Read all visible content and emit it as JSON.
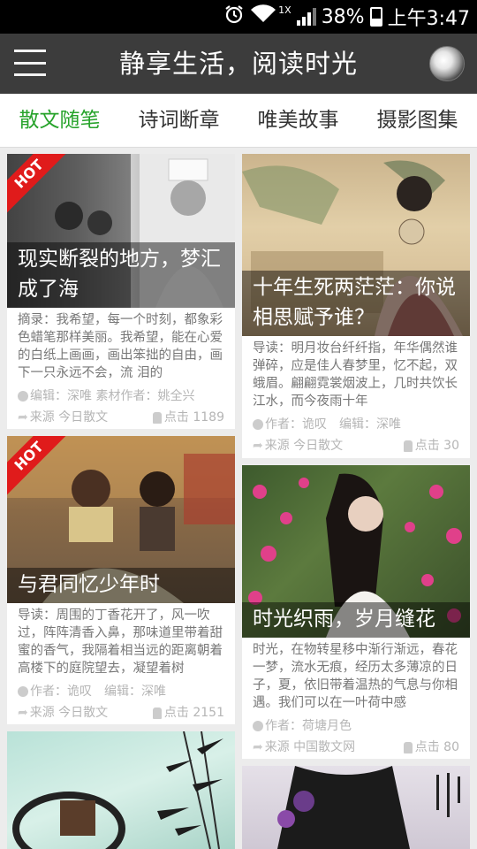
{
  "status": {
    "network": "1X",
    "battery": "38%",
    "time": "上午3:47"
  },
  "header": {
    "title": "静享生活，阅读时光"
  },
  "tabs": [
    "散文随笔",
    "诗词断章",
    "唯美故事",
    "摄影图集"
  ],
  "cards": [
    {
      "hot": "HOT",
      "title": "现实断裂的地方，梦汇成了海",
      "summary": "摘录：我希望，每一个时刻，都象彩色蜡笔那样美丽。我希望，能在心爱的白纸上画画，画出笨拙的自由，画下一只永远不会，流 泪的",
      "meta": "编辑：深唯 素材作者：姚全兴",
      "source": "来源 今日散文",
      "views": "点击 1189"
    },
    {
      "title": "十年生死两茫茫：你说相思赋予谁？",
      "summary": "导读：明月妆台纤纤指，年华偶然谁弹碎，应是佳人春梦里，忆不起，双蛾眉。翩翩霓裳烟波上，几时共饮长江水，而今夜雨十年",
      "meta": "作者：诡叹　编辑：深唯",
      "source": "来源 今日散文",
      "views": "点击 30"
    },
    {
      "hot": "HOT",
      "title": "与君同忆少年时",
      "summary": "导读：周围的丁香花开了，风一吹过，阵阵清香入鼻，那味道里带着甜蜜的香气，我隔着相当远的距离朝着高楼下的庭院望去，凝望着树",
      "meta": "作者：诡叹　编辑：深唯",
      "source": "来源 今日散文",
      "views": "点击 2151"
    },
    {
      "title": "时光织雨，岁月缝花",
      "summary": "时光，在物转星移中渐行渐远，春花一梦，流水无痕，经历太多薄凉的日子，夏，依旧带着温热的气息与你相遇。我们可以在一叶荷中感",
      "meta": "作者：荷塘月色",
      "source": "来源 中国散文网",
      "views": "点击 80"
    }
  ]
}
